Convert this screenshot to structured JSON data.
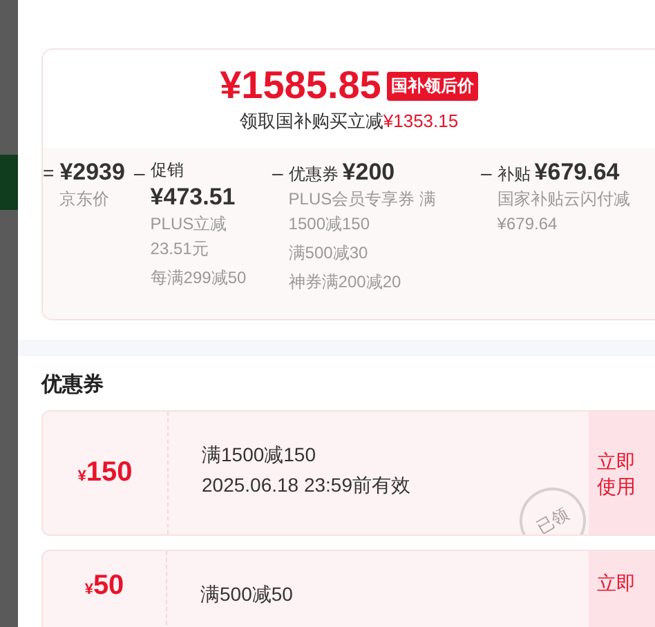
{
  "price": {
    "amount": "¥1585.85",
    "tag": "国补领后价",
    "note": "领取国补购买立减",
    "note_amount": "¥1353.15"
  },
  "breakdown": [
    {
      "op": "=",
      "kind": "inline",
      "amount": "¥2939",
      "details": [
        "京东价"
      ]
    },
    {
      "op": "–",
      "kind": "stacked",
      "label": "促销",
      "amount": "¥473.51",
      "details": [
        "PLUS立减\n23.51元",
        "每满299减50"
      ]
    },
    {
      "op": "–",
      "kind": "inline",
      "label": "优惠券",
      "amount": "¥200",
      "details": [
        "PLUS会员专享券 满\n1500减150",
        "满500减30",
        "神券满200减20"
      ]
    },
    {
      "op": "–",
      "kind": "inline",
      "label": "补贴",
      "amount": "¥679.64",
      "details": [
        "国家补贴云闪付减\n¥679.64"
      ]
    }
  ],
  "coupons_title": "优惠券",
  "coupons": [
    {
      "currency": "¥",
      "value": "150",
      "condition": "满1500减150",
      "validity": "2025.06.18 23:59前有效",
      "stamp": "已领",
      "button": "立即使用"
    },
    {
      "currency": "¥",
      "value": "50",
      "condition": "满500减50",
      "button": "立即"
    }
  ]
}
